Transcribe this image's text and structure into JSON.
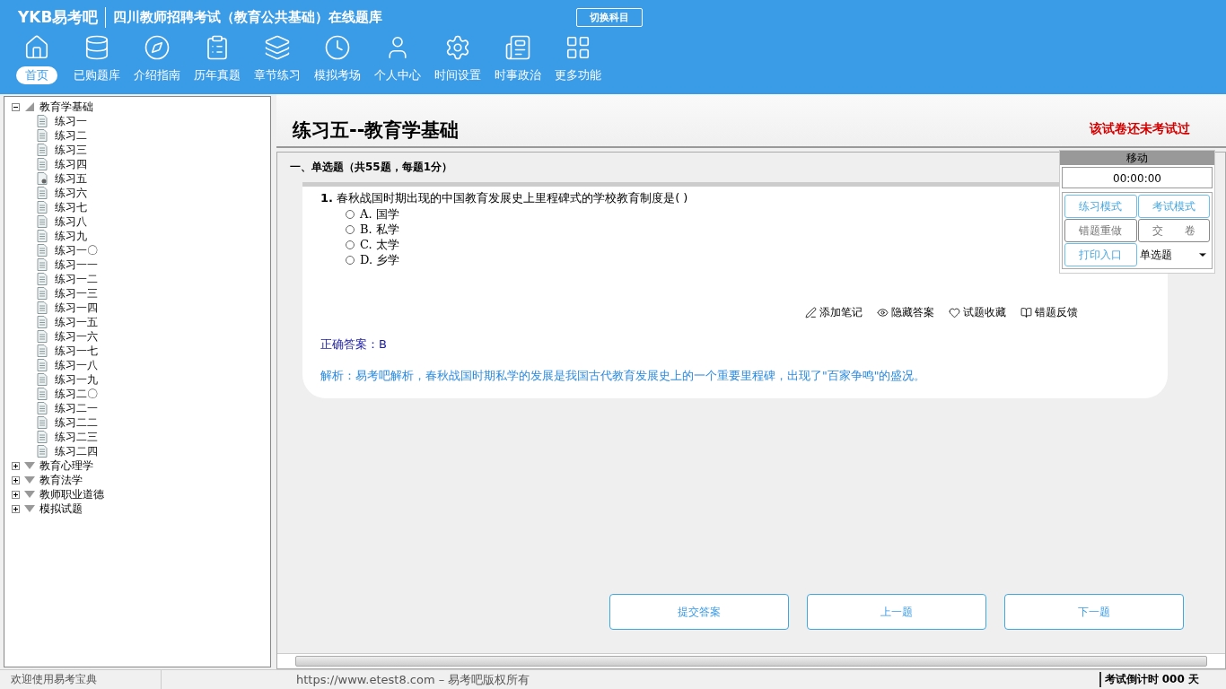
{
  "header": {
    "logo": "YKB易考吧",
    "title": "四川教师招聘考试（教育公共基础）在线题库",
    "switch_button": "切换科目"
  },
  "nav": [
    {
      "label": "首页",
      "selected": true
    },
    {
      "label": "已购题库",
      "selected": false
    },
    {
      "label": "介绍指南",
      "selected": false
    },
    {
      "label": "历年真题",
      "selected": false
    },
    {
      "label": "章节练习",
      "selected": false
    },
    {
      "label": "模拟考场",
      "selected": false
    },
    {
      "label": "个人中心",
      "selected": false
    },
    {
      "label": "时间设置",
      "selected": false
    },
    {
      "label": "时事政治",
      "selected": false
    },
    {
      "label": "更多功能",
      "selected": false
    }
  ],
  "tree": [
    {
      "label": "教育学基础",
      "expanded": true,
      "children": [
        {
          "label": "练习一",
          "selected": false
        },
        {
          "label": "练习二",
          "selected": false
        },
        {
          "label": "练习三",
          "selected": false
        },
        {
          "label": "练习四",
          "selected": false
        },
        {
          "label": "练习五",
          "selected": true
        },
        {
          "label": "练习六",
          "selected": false
        },
        {
          "label": "练习七",
          "selected": false
        },
        {
          "label": "练习八",
          "selected": false
        },
        {
          "label": "练习九",
          "selected": false
        },
        {
          "label": "练习一〇",
          "selected": false
        },
        {
          "label": "练习一一",
          "selected": false
        },
        {
          "label": "练习一二",
          "selected": false
        },
        {
          "label": "练习一三",
          "selected": false
        },
        {
          "label": "练习一四",
          "selected": false
        },
        {
          "label": "练习一五",
          "selected": false
        },
        {
          "label": "练习一六",
          "selected": false
        },
        {
          "label": "练习一七",
          "selected": false
        },
        {
          "label": "练习一八",
          "selected": false
        },
        {
          "label": "练习一九",
          "selected": false
        },
        {
          "label": "练习二〇",
          "selected": false
        },
        {
          "label": "练习二一",
          "selected": false
        },
        {
          "label": "练习二二",
          "selected": false
        },
        {
          "label": "练习二三",
          "selected": false
        },
        {
          "label": "练习二四",
          "selected": false
        }
      ]
    },
    {
      "label": "教育心理学",
      "expanded": false
    },
    {
      "label": "教育法学",
      "expanded": false
    },
    {
      "label": "教师职业道德",
      "expanded": false
    },
    {
      "label": "模拟试题",
      "expanded": false
    }
  ],
  "paper": {
    "title": "练习五--教育学基础",
    "status": "该试卷还未考试过"
  },
  "section": "一、单选题（共55题，每题1分）",
  "question": {
    "number": "1.",
    "text": "春秋战国时期出现的中国教育发展史上里程碑式的学校教育制度是( )",
    "options": [
      {
        "label": "A. 国学",
        "selected": false
      },
      {
        "label": "B. 私学",
        "selected": false
      },
      {
        "label": "C. 太学",
        "selected": false
      },
      {
        "label": "D. 乡学",
        "selected": false
      }
    ],
    "actions": [
      "添加笔记",
      "隐藏答案",
      "试题收藏",
      "错题反馈"
    ],
    "answer": "正确答案：B",
    "analysis": "解析：易考吧解析，春秋战国时期私学的发展是我国古代教育发展史上的一个重要里程碑，出现了\"百家争鸣\"的盛况。"
  },
  "float_panel": {
    "handle": "移动",
    "timer": "00:00:00",
    "buttons": [
      {
        "label": "练习模式",
        "disabled": false
      },
      {
        "label": "考试模式",
        "disabled": false
      },
      {
        "label": "错题重做",
        "disabled": true
      },
      {
        "label": "交　　卷",
        "disabled": true
      },
      {
        "label": "打印入口",
        "disabled": false
      }
    ],
    "type_select": "单选题"
  },
  "bottom_buttons": [
    "提交答案",
    "上一题",
    "下一题"
  ],
  "status_bar": {
    "welcome": "欢迎使用易考宝典",
    "copyright": "https://www.etest8.com – 易考吧版权所有",
    "countdown": "考试倒计时 000 天"
  }
}
